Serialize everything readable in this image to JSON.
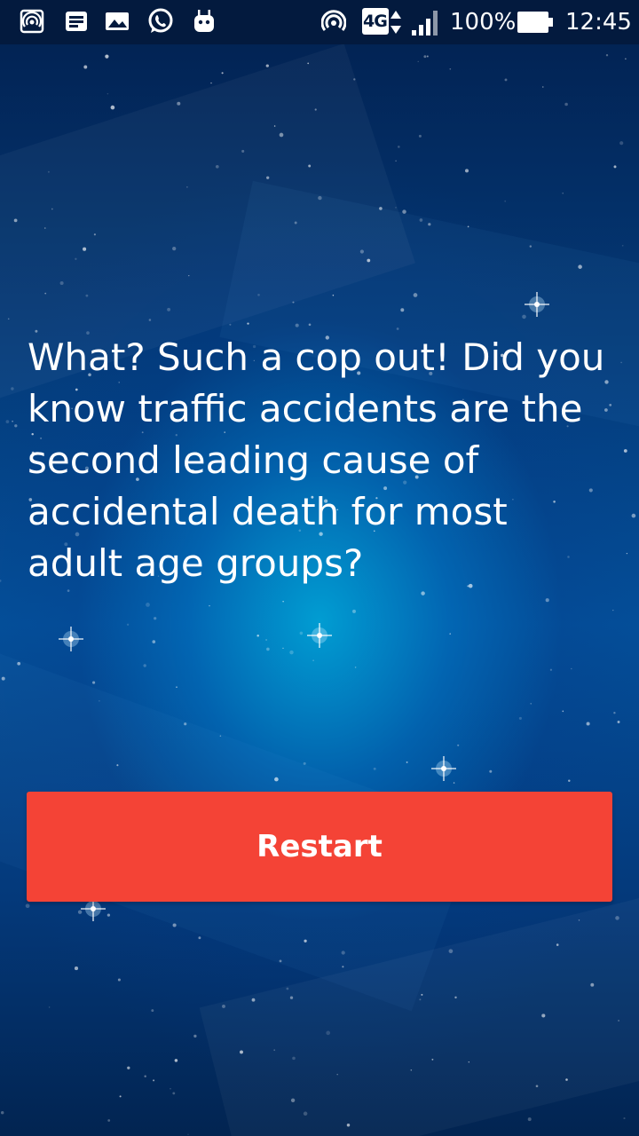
{
  "status_bar": {
    "left_icons": [
      "hotspot-icon",
      "news-icon",
      "image-icon",
      "whatsapp-icon",
      "android-icon"
    ],
    "right_icons": [
      "hotspot-icon",
      "network-4g-icon",
      "signal-icon",
      "battery-icon"
    ],
    "network_type": "4G",
    "battery_percent": "100%",
    "battery_level": 1.0,
    "time": "12:45"
  },
  "main": {
    "message": "What? Such a cop out! Did you know traffic accidents are the second leading cause of accidental death for most adult age groups?",
    "restart_label": "Restart"
  },
  "colors": {
    "status_bar_bg": "#031a3e",
    "background_dark": "#022451",
    "background_glow": "#00aadc",
    "button_bg": "#f44336",
    "text": "#ffffff"
  }
}
